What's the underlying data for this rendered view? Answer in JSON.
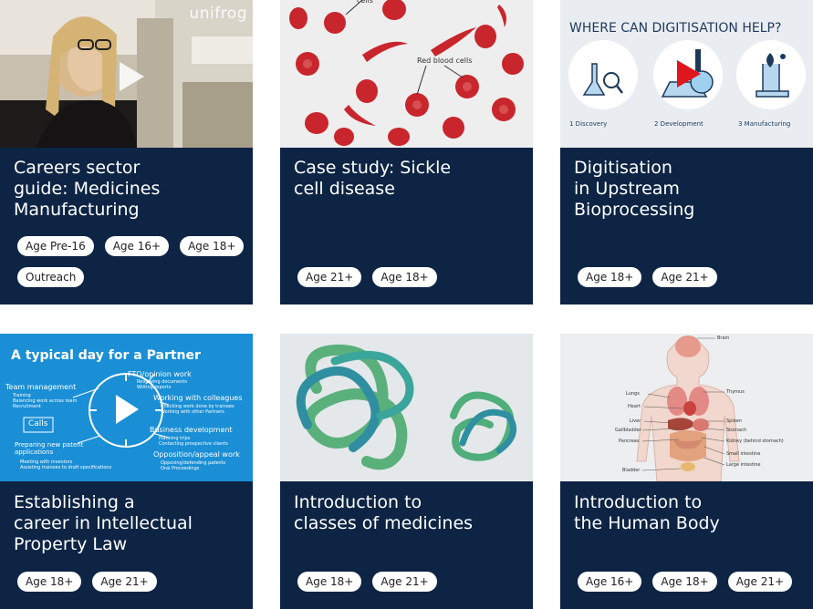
{
  "cards": [
    {
      "title_lines": [
        "Careers sector",
        "guide: Medicines",
        "Manufacturing"
      ],
      "tags": [
        "Age Pre-16",
        "Age 16+",
        "Age 18+",
        "Outreach"
      ],
      "thumb": {
        "logo": "unifrog"
      }
    },
    {
      "title_lines": [
        "Case study: Sickle",
        "cell disease"
      ],
      "tags": [
        "Age 21+",
        "Age 18+"
      ],
      "thumb": {
        "label_top": "cells",
        "label": "Red blood cells"
      }
    },
    {
      "title_lines": [
        "Digitisation",
        "in Upstream",
        "Bioprocessing"
      ],
      "tags": [
        "Age 18+",
        "Age 21+"
      ],
      "thumb": {
        "heading": "WHERE CAN DIGITISATION HELP?",
        "steps": [
          "1 Discovery",
          "2 Development",
          "3 Manufacturing"
        ]
      }
    },
    {
      "title_lines": [
        "Establishing a",
        "career in Intellectual",
        "Property Law"
      ],
      "tags": [
        "Age 18+",
        "Age 21+"
      ],
      "thumb": {
        "heading": "A typical day for a Partner",
        "team": "Team management",
        "team_items": [
          "Training",
          "Balancing work across team",
          "Recruitment"
        ],
        "calls": "Calls",
        "preparing": "Preparing new patent applications",
        "preparing_items": [
          "Meeting with inventors",
          "Assisting trainees to draft specifications"
        ],
        "fto": "FTO/opinion work",
        "fto_items": [
          "Reviewing documents",
          "Writing reports"
        ],
        "colleagues": "Working with colleagues",
        "colleagues_items": [
          "Checking work done by trainees",
          "Working with other Partners"
        ],
        "business": "Business development",
        "business_items": [
          "Planning trips",
          "Contacting prospective clients"
        ],
        "opposition": "Opposition/appeal work",
        "opposition_items": [
          "Opposing/defending patents",
          "Oral Proceedings"
        ]
      }
    },
    {
      "title_lines": [
        "Introduction to",
        "classes of medicines"
      ],
      "tags": [
        "Age 18+",
        "Age 21+"
      ],
      "thumb": {}
    },
    {
      "title_lines": [
        "Introduction to",
        "the Human Body"
      ],
      "tags": [
        "Age 16+",
        "Age 18+",
        "Age 21+"
      ],
      "thumb": {
        "labels_left": [
          "Lungs",
          "Heart",
          "Liver",
          "Gallbladder",
          "Pancreas",
          "Bladder"
        ],
        "labels_right": [
          "Brain",
          "Thymus",
          "Spleen",
          "Stomach",
          "Kidney (behind stomach)",
          "Small intestine",
          "Large intestine"
        ]
      }
    }
  ]
}
